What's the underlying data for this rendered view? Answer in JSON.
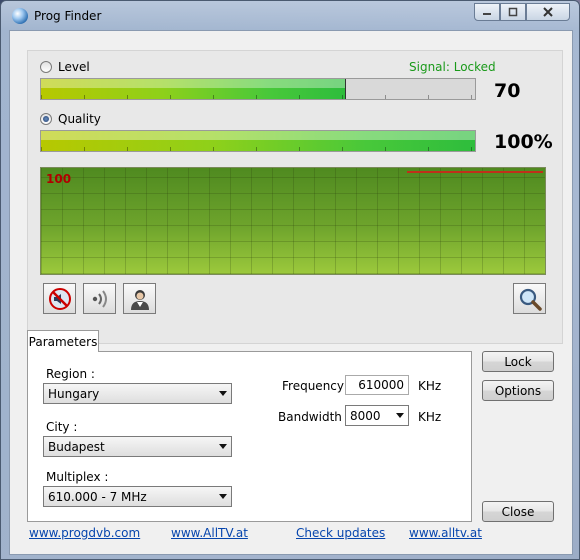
{
  "window": {
    "title": "Prog Finder"
  },
  "caption_buttons": {
    "minimize": "▭",
    "maximize": "◻",
    "close": "✕"
  },
  "level": {
    "label": "Level",
    "value_text": "70",
    "fill_percent": 70,
    "selected": false
  },
  "signal_status": "Signal: Locked",
  "quality": {
    "label": "Quality",
    "value_text": "100%",
    "fill_percent": 100,
    "selected": true
  },
  "graph": {
    "label": "100"
  },
  "toolbar": {
    "icons": [
      "speaker-muted-icon",
      "signal-waves-icon",
      "person-icon",
      "magnifier-icon"
    ]
  },
  "tabs": [
    {
      "label": "Parameters",
      "active": true
    }
  ],
  "parameters": {
    "region_label": "Region :",
    "region_value": "Hungary",
    "city_label": "City :",
    "city_value": "Budapest",
    "multiplex_label": "Multiplex :",
    "multiplex_value": "610.000 - 7 MHz",
    "frequency_label": "Frequency :",
    "frequency_value": "610000",
    "frequency_unit": "KHz",
    "bandwidth_label": "Bandwidth :",
    "bandwidth_value": "8000",
    "bandwidth_unit": "KHz"
  },
  "buttons": {
    "lock": "Lock",
    "options": "Options",
    "close": "Close"
  },
  "links": [
    "www.progdvb.com",
    "www.AllTV.at",
    "Check updates",
    "www.alltv.at"
  ],
  "colors": {
    "signal_text": "#1a9a1a",
    "graph_label": "#b00000",
    "link": "#0645ad"
  }
}
